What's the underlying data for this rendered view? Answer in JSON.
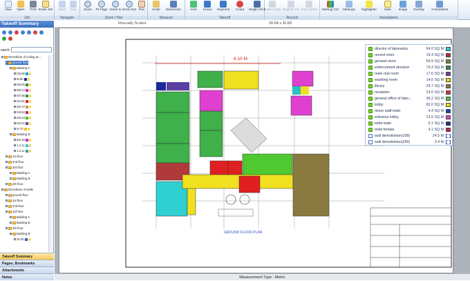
{
  "ribbon": {
    "buttons": [
      {
        "label": "New",
        "icon": "new-icon"
      },
      {
        "label": "Open",
        "icon": "open-icon"
      },
      {
        "label": "Print",
        "icon": "print-icon"
      },
      {
        "label": "Email Job",
        "icon": "email-icon"
      },
      {
        "label": "Back",
        "icon": "back-icon",
        "disabled": true
      },
      {
        "label": "Fwd",
        "icon": "forward-icon",
        "disabled": true
      },
      {
        "label": "Fit Page",
        "icon": "fit-page-icon"
      },
      {
        "label": "Zoom In",
        "icon": "zoom-in-icon"
      },
      {
        "label": "Zoom Out",
        "icon": "zoom-out-icon"
      },
      {
        "label": "Pan",
        "icon": "pan-icon"
      },
      {
        "label": "Scale",
        "icon": "scale-icon"
      },
      {
        "label": "Dimension",
        "icon": "dimension-icon"
      },
      {
        "label": "Area",
        "icon": "area-icon"
      },
      {
        "label": "Linear",
        "icon": "linear-icon"
      },
      {
        "label": "Segment",
        "icon": "segment-icon"
      },
      {
        "label": "Count",
        "icon": "count-icon"
      },
      {
        "label": "Single Click",
        "icon": "single-click-icon"
      },
      {
        "label": "Select Data",
        "icon": "select-data-icon",
        "disabled": true
      },
      {
        "label": "Digitizer Record",
        "icon": "digitizer-icon",
        "disabled": true
      },
      {
        "label": "New Section",
        "icon": "new-section-icon",
        "disabled": true
      },
      {
        "label": "Markup Color",
        "icon": "markup-color-icon"
      },
      {
        "label": "Markups",
        "icon": "markups-icon"
      },
      {
        "label": "Highlighter",
        "icon": "highlighter-icon"
      },
      {
        "label": "Note",
        "icon": "note-icon"
      },
      {
        "label": "Image",
        "icon": "image-icon"
      },
      {
        "label": "Overlay",
        "icon": "overlay-icon"
      },
      {
        "label": "Annotations",
        "icon": "annotations-icon"
      }
    ],
    "groups": [
      "Job",
      "Navigate",
      "Zoom / Pan",
      "Measure",
      "Takeoff",
      "Record",
      "Annotations"
    ]
  },
  "left_pane": {
    "title": "Takeoff Summary",
    "search_label": "earch:",
    "tree": [
      {
        "label": "Demolition of ceiling an...",
        "level": 0,
        "kind": "folder"
      },
      {
        "label": "ground floor",
        "level": 1,
        "kind": "folder",
        "selected": true
      },
      {
        "label": "Building A",
        "level": 2,
        "kind": "folder"
      },
      {
        "label": "t33.98",
        "level": 3,
        "kind": "item",
        "color": "#00a0e0"
      },
      {
        "label": "t9.90",
        "level": 3,
        "kind": "item",
        "color": "#1a2a9a"
      },
      {
        "label": "t35.90",
        "level": 3,
        "kind": "item",
        "color": "#2d8a3e"
      },
      {
        "label": "t95.34",
        "level": 3,
        "kind": "item",
        "color": "#e020c0"
      },
      {
        "label": "t47.65",
        "level": 3,
        "kind": "item",
        "color": "#20a050"
      },
      {
        "label": "t44.61",
        "level": 3,
        "kind": "item",
        "color": "#e02020"
      },
      {
        "label": "t26.72",
        "level": 3,
        "kind": "item",
        "color": "#b7a060"
      },
      {
        "label": "t33.53",
        "level": 3,
        "kind": "item",
        "color": "#c02080"
      },
      {
        "label": "t46.23",
        "level": 3,
        "kind": "item",
        "color": "#40c040"
      },
      {
        "label": "t22.02",
        "level": 3,
        "kind": "item",
        "color": "#6040a0"
      },
      {
        "label": "t4.70",
        "level": 3,
        "kind": "item",
        "color": "#f0c000"
      },
      {
        "label": "Building B",
        "level": 2,
        "kind": "folder"
      },
      {
        "label": "t62.36",
        "level": 3,
        "kind": "item",
        "color": "#d020d0"
      },
      {
        "label": "1.2.11",
        "level": 3,
        "kind": "item",
        "color": "#30c0e0"
      },
      {
        "label": "1.3.11",
        "level": 3,
        "kind": "item",
        "color": "#30a0a0"
      },
      {
        "label": "1st floor",
        "level": 1,
        "kind": "folder"
      },
      {
        "label": "2nd floor",
        "level": 1,
        "kind": "folder"
      },
      {
        "label": "3rd floor",
        "level": 1,
        "kind": "folder"
      },
      {
        "label": "Building A",
        "level": 2,
        "kind": "folder"
      },
      {
        "label": "Building B",
        "level": 2,
        "kind": "folder"
      },
      {
        "label": "4th floor",
        "level": 1,
        "kind": "folder"
      },
      {
        "label": "Demolition of walls",
        "level": 0,
        "kind": "folder"
      },
      {
        "label": "ground floor",
        "level": 1,
        "kind": "folder"
      },
      {
        "label": "1st floor",
        "level": 1,
        "kind": "folder"
      },
      {
        "label": "2nd floor",
        "level": 1,
        "kind": "folder"
      },
      {
        "label": "3rd floor",
        "level": 1,
        "kind": "folder"
      },
      {
        "label": "Building A",
        "level": 2,
        "kind": "folder"
      },
      {
        "label": "Building B",
        "level": 2,
        "kind": "folder"
      },
      {
        "label": "4th floor",
        "level": 1,
        "kind": "folder"
      },
      {
        "label": "Building B",
        "level": 2,
        "kind": "folder"
      },
      {
        "label": "z6.30",
        "level": 3,
        "kind": "item",
        "color": "#3060d0"
      }
    ],
    "bottom_tabs": [
      "Takeoff Summary",
      "Pages, Bookmarks",
      "Attachments",
      "Notes"
    ]
  },
  "document": {
    "scale_note": "Manually Scaled",
    "page_size": "16.54 x 11.69",
    "dimension_label": "6.10 M",
    "plan_title": "GROUND FLOOR PLAN",
    "legend": [
      {
        "name": "director of laboratory",
        "value": "64.0 SQ M",
        "color": "#2fd0d0"
      },
      {
        "name": "record room",
        "value": "19.4 SQ M",
        "color": "#b03030"
      },
      {
        "name": "genaral store",
        "value": "69.9 SQ M",
        "color": "#6c8a28"
      },
      {
        "name": "enforcement devision",
        "value": "79.3 SQ M",
        "color": "#3a8a50"
      },
      {
        "name": "male rest room",
        "value": "17.6 SQ M",
        "color": "#7a3aa0"
      },
      {
        "name": "washing room",
        "value": "14.6 SQ M",
        "color": "#f0d020"
      },
      {
        "name": "library",
        "value": "29.7 SQ M",
        "color": "#8a7a40"
      },
      {
        "name": "reception",
        "value": "23.5 SQ M",
        "color": "#d03a3a"
      },
      {
        "name": "general office of labo...",
        "value": "36.2 SQ M",
        "color": "#50c830"
      },
      {
        "name": "lobby",
        "value": "82.0 SQ M",
        "color": "#f0e020"
      },
      {
        "name": "minor staff toilet",
        "value": "4.4 SQ M",
        "color": "#2040a0"
      },
      {
        "name": "entrance lobby",
        "value": "23.6 SQ M",
        "color": "#e040d0"
      },
      {
        "name": "toilet male",
        "value": "5.1 SQ M",
        "color": "#2a2a80"
      },
      {
        "name": "toilet female",
        "value": "4.1 SQ M",
        "color": "#c02060"
      },
      {
        "name": "wall demolishion(100)",
        "value": "24.5 M",
        "color": "#3050c0",
        "dashed": true
      },
      {
        "name": "wall demolishion(200)",
        "value": "3.4 M",
        "color": "#3050c0",
        "dashed": true
      }
    ]
  },
  "status": {
    "measurement_type": "Measurement Type : Metric"
  }
}
